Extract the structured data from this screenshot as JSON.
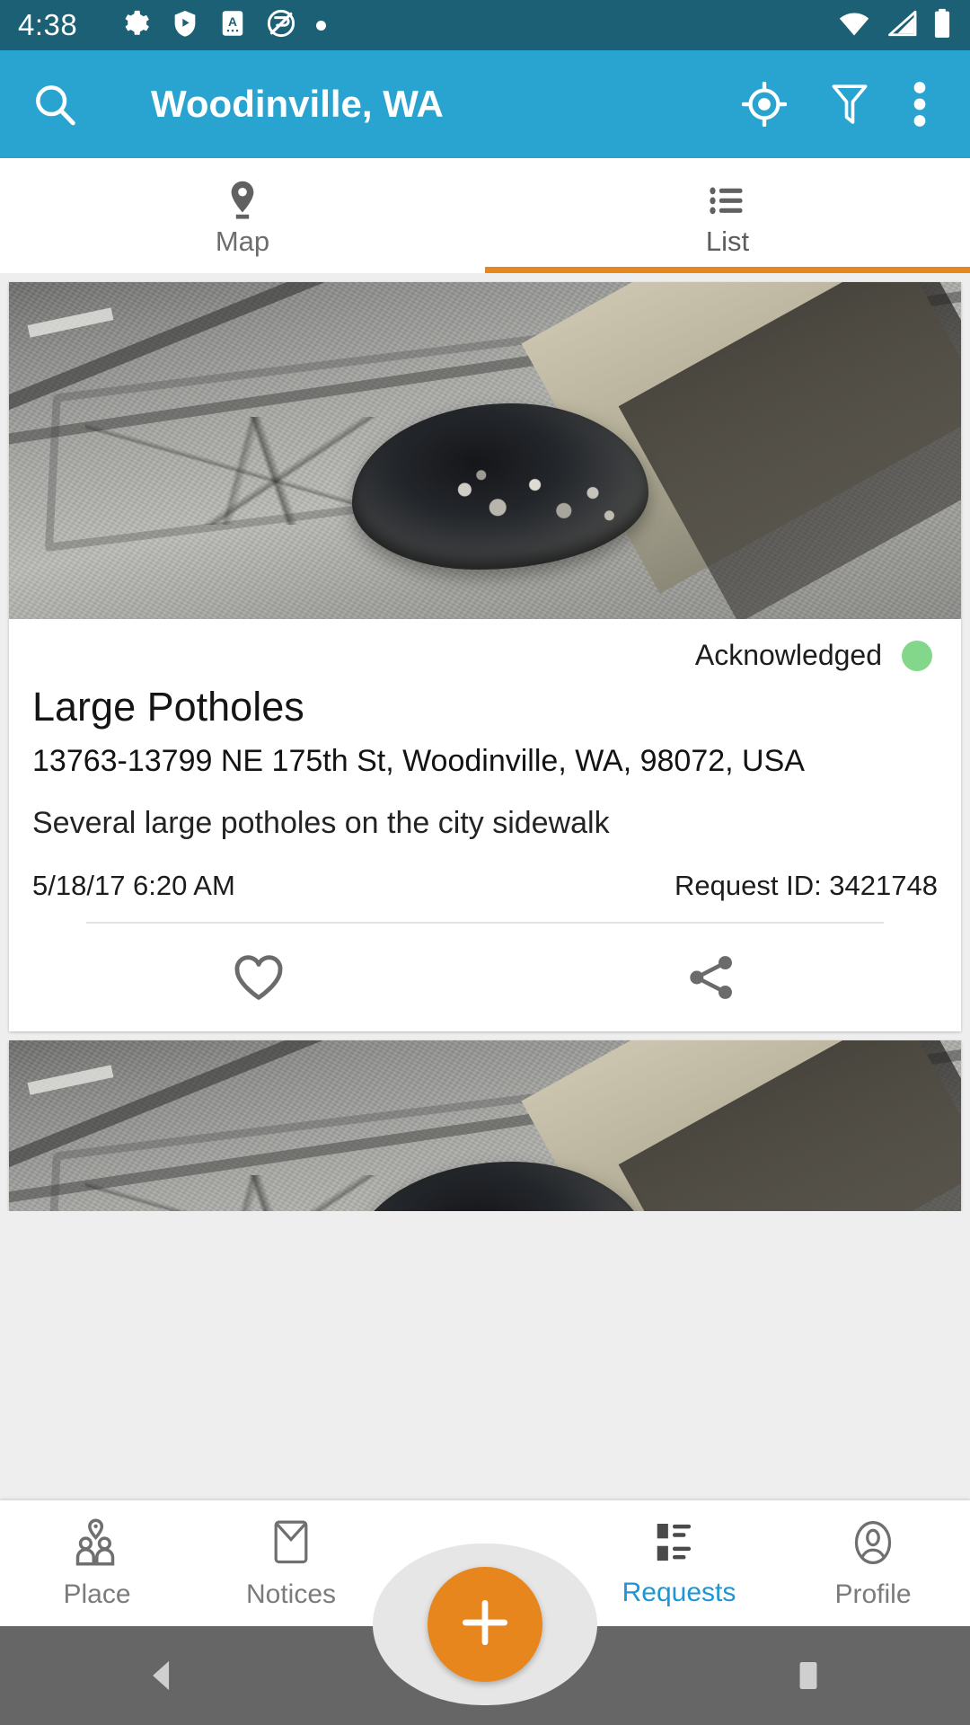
{
  "status_bar": {
    "time": "4:38",
    "left_icons": [
      "gear-icon",
      "shield-play-icon",
      "a-badge-icon",
      "do-not-disturb-icon",
      "dot-icon"
    ],
    "right_icons": [
      "wifi-icon",
      "cell-signal-icon",
      "battery-icon"
    ],
    "background_color": "#1b6075"
  },
  "toolbar": {
    "title": "Woodinville, WA",
    "search_icon": "search-icon",
    "my_location_icon": "my-location-icon",
    "filter_icon": "filter-icon",
    "overflow_icon": "overflow-menu-icon",
    "background_color": "#29a3d0"
  },
  "tabs": {
    "active": "List",
    "indicator_color": "#e8861e",
    "items": [
      {
        "label": "Map",
        "icon": "map-pin-icon",
        "active": false
      },
      {
        "label": "List",
        "icon": "list-icon",
        "active": true
      }
    ]
  },
  "requests": [
    {
      "photo_alt": "pothole-photo",
      "status": "Acknowledged",
      "status_color": "#83d78a",
      "title": "Large Potholes",
      "address": "13763-13799 NE 175th St, Woodinville, WA, 98072, USA",
      "description": "Several large potholes on the city sidewalk",
      "date": "5/18/17 6:20 AM",
      "request_id": "Request ID: 3421748",
      "favorite_icon": "heart-icon",
      "share_icon": "share-icon"
    },
    {
      "photo_alt": "pothole-photo"
    }
  ],
  "bottom_nav": {
    "active": "Requests",
    "active_color": "#1c96d4",
    "fab": {
      "icon": "plus-icon",
      "color": "#e8861e"
    },
    "items": [
      {
        "label": "Place",
        "icon": "place-people-icon",
        "active": false
      },
      {
        "label": "Notices",
        "icon": "envelope-icon",
        "active": false
      },
      {
        "label": "Requests",
        "icon": "requests-list-icon",
        "active": true
      },
      {
        "label": "Profile",
        "icon": "profile-icon",
        "active": false
      }
    ]
  },
  "android_nav": {
    "back_icon": "back-triangle-icon",
    "home_icon": "home-circle-icon",
    "recents_icon": "recents-square-icon",
    "background_color": "#666666"
  }
}
